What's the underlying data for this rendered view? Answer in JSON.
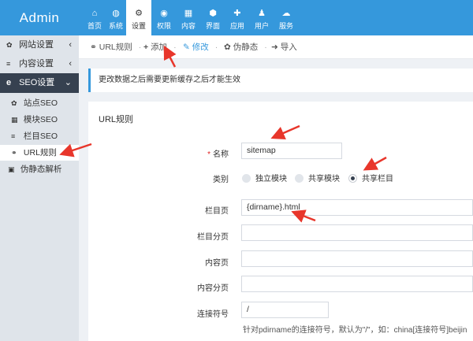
{
  "app": {
    "title": "Admin"
  },
  "topnav": [
    {
      "label": "首页",
      "icon": "home-icon",
      "glyph": "⌂"
    },
    {
      "label": "系统",
      "icon": "globe-icon",
      "glyph": "◍"
    },
    {
      "label": "设置",
      "icon": "gears-icon",
      "glyph": "⚙"
    },
    {
      "label": "权限",
      "icon": "shield-icon",
      "glyph": "◉"
    },
    {
      "label": "内容",
      "icon": "grid-icon",
      "glyph": "▦"
    },
    {
      "label": "界面",
      "icon": "html5-icon",
      "glyph": "⬢"
    },
    {
      "label": "应用",
      "icon": "puzzle-icon",
      "glyph": "✚"
    },
    {
      "label": "用户",
      "icon": "users-icon",
      "glyph": "♟"
    },
    {
      "label": "服务",
      "icon": "cloud-icon",
      "glyph": "☁"
    }
  ],
  "sidebar": {
    "groups": [
      {
        "label": "网站设置",
        "icon": "gear-icon",
        "glyph": "✿"
      },
      {
        "label": "内容设置",
        "icon": "list-icon",
        "glyph": "≡"
      },
      {
        "label": "SEO设置",
        "icon": "ie-icon",
        "glyph": "e"
      }
    ],
    "items": [
      {
        "label": "站点SEO",
        "icon": "gear-icon",
        "glyph": "✿"
      },
      {
        "label": "模块SEO",
        "icon": "th-icon",
        "glyph": "▦"
      },
      {
        "label": "栏目SEO",
        "icon": "list-icon",
        "glyph": "≡"
      },
      {
        "label": "URL规则",
        "icon": "link-icon",
        "glyph": "⚭"
      }
    ],
    "extra": {
      "label": "伪静态解析",
      "icon": "code-icon",
      "glyph": "▣"
    }
  },
  "tabs": [
    {
      "label": "URL规则",
      "icon": "link-icon",
      "glyph": "⚭"
    },
    {
      "label": "添加",
      "icon": "plus-icon",
      "glyph": "+"
    },
    {
      "label": "修改",
      "icon": "edit-icon",
      "glyph": "✎"
    },
    {
      "label": "伪静态",
      "icon": "gear-icon",
      "glyph": "✿"
    },
    {
      "label": "导入",
      "icon": "import-icon",
      "glyph": "➜"
    }
  ],
  "notice": "更改数据之后需要更新缓存之后才能生效",
  "form": {
    "title": "URL规则",
    "name_label": "名称",
    "name_required": "*",
    "name_value": "sitemap",
    "type_label": "类别",
    "type_options": [
      "独立模块",
      "共享模块",
      "共享栏目"
    ],
    "type_selected": "共享栏目",
    "category_page_label": "栏目页",
    "category_page_value": "{dirname}.html",
    "category_paging_label": "栏目分页",
    "content_page_label": "内容页",
    "content_paging_label": "内容分页",
    "connector_label": "连接符号",
    "connector_value": "/",
    "connector_help": "针对pdirname的连接符号，默认为\"/\"，如：china[连接符号]beijin"
  },
  "colors": {
    "primary": "#3598dc",
    "sidebar_dark": "#364150",
    "arrow": "#e8362b"
  }
}
